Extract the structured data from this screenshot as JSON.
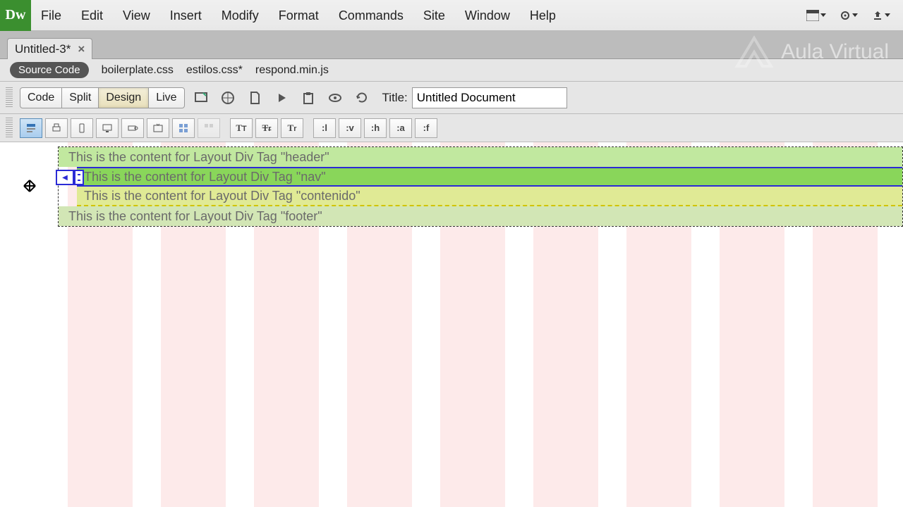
{
  "menubar": {
    "items": [
      "File",
      "Edit",
      "View",
      "Insert",
      "Modify",
      "Format",
      "Commands",
      "Site",
      "Window",
      "Help"
    ]
  },
  "tab": {
    "filename": "Untitled-3*",
    "close": "×"
  },
  "watermark": "Aula Virtual",
  "related": {
    "source_pill": "Source Code",
    "files": [
      "boilerplate.css",
      "estilos.css*",
      "respond.min.js"
    ]
  },
  "toolbar1": {
    "views": {
      "code": "Code",
      "split": "Split",
      "design": "Design",
      "live": "Live"
    },
    "title_label": "Title:",
    "title_value": "Untitled Document"
  },
  "toolbar2": {
    "pseudo": {
      "l": ":l",
      "v": ":v",
      "h": ":h",
      "a": ":a",
      "f": ":f"
    }
  },
  "layout": {
    "header": "This is the content for Layout Div Tag \"header\"",
    "nav": "This is the content for Layout Div Tag \"nav\"",
    "contenido": "This is the content for Layout Div Tag \"contenido\"",
    "footer": "This is the content for Layout Div Tag \"footer\""
  }
}
